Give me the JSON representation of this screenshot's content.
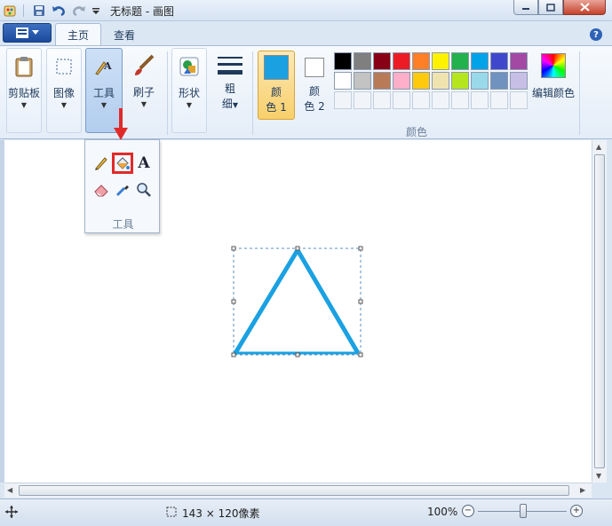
{
  "window": {
    "title": "无标题 - 画图"
  },
  "tabs": {
    "home": "主页",
    "view": "查看"
  },
  "ribbon": {
    "clipboard": "剪贴板",
    "image": "图像",
    "tools": "工具",
    "brushes": "刷子",
    "shapes": "形状",
    "size_line1": "粗",
    "size_line2": "细",
    "color1_line1": "颜",
    "color1_line2": "色 1",
    "color2_line1": "颜",
    "color2_line2": "色 2",
    "palette_label": "颜色",
    "edit_colors": "编辑颜色",
    "color1_value": "#1ba1e2",
    "color2_value": "#ffffff",
    "palette_row1": [
      "#000000",
      "#7f7f7f",
      "#880015",
      "#ed1c24",
      "#ff7f27",
      "#fff200",
      "#22b14c",
      "#00a2e8",
      "#3f48cc",
      "#a349a4"
    ],
    "palette_row2": [
      "#ffffff",
      "#c3c3c3",
      "#b97a57",
      "#ffaec9",
      "#ffc90e",
      "#efe4b0",
      "#b5e61d",
      "#99d9ea",
      "#7092be",
      "#c8bfe7"
    ]
  },
  "tools_popup": {
    "caption": "工具",
    "items": [
      "pencil-icon",
      "fill-bucket-icon",
      "text-icon",
      "eraser-icon",
      "color-picker-icon",
      "magnifier-icon"
    ],
    "text_tool_glyph": "A"
  },
  "drawing": {
    "stroke_color": "#1ba1e2"
  },
  "status": {
    "size": "143 × 120像素",
    "zoom": "100%"
  }
}
